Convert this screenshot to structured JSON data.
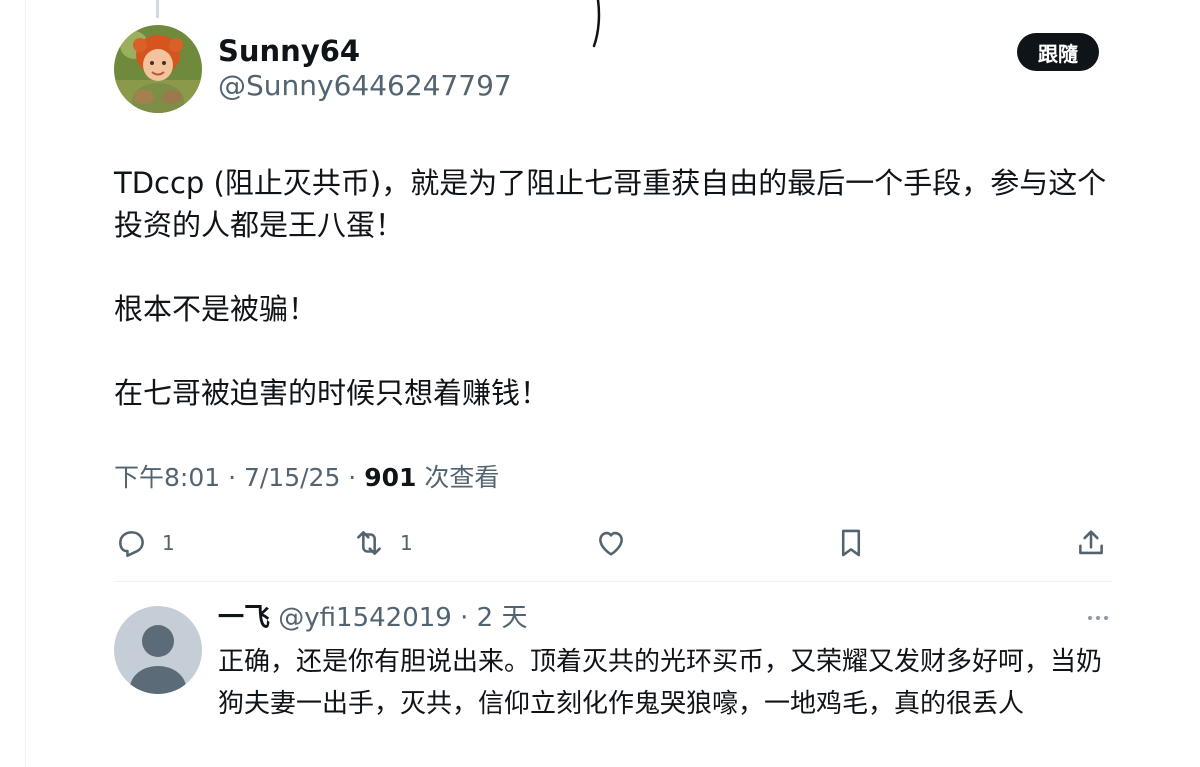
{
  "tweet": {
    "author_name": "Sunny64",
    "author_handle": "@Sunny6446247797",
    "follow_label": "跟隨",
    "paragraphs": [
      "TDccp (阻止灭共币)，就是为了阻止七哥重获自由的最后一个手段，参与这个投资的人都是王八蛋！",
      "根本不是被骗！",
      "在七哥被迫害的时候只想着赚钱！"
    ],
    "time": "下午8:01 · 7/15/25 · ",
    "views_count": "901",
    "views_label": " 次查看",
    "actions": {
      "reply_count": "1",
      "retweet_count": "1"
    }
  },
  "reply": {
    "name": "一飞",
    "handle_time": " @yfi1542019 · 2 天",
    "text": "正确，还是你有胆说出来。顶着灭共的光环买币，又荣耀又发财多好呵，当奶狗夫妻一出手，灭共，信仰立刻化作鬼哭狼嚎，一地鸡毛，真的很丢人"
  },
  "icons": {
    "reply": "reply-icon",
    "retweet": "retweet-icon",
    "like": "heart-icon",
    "bookmark": "bookmark-icon",
    "share": "share-icon",
    "more": "more-icon"
  },
  "colors": {
    "text": "#0f1419",
    "secondary": "#536471",
    "follow_bg": "#0f1419",
    "divider": "#eff3f4",
    "default_avatar": "#c5ced6"
  }
}
